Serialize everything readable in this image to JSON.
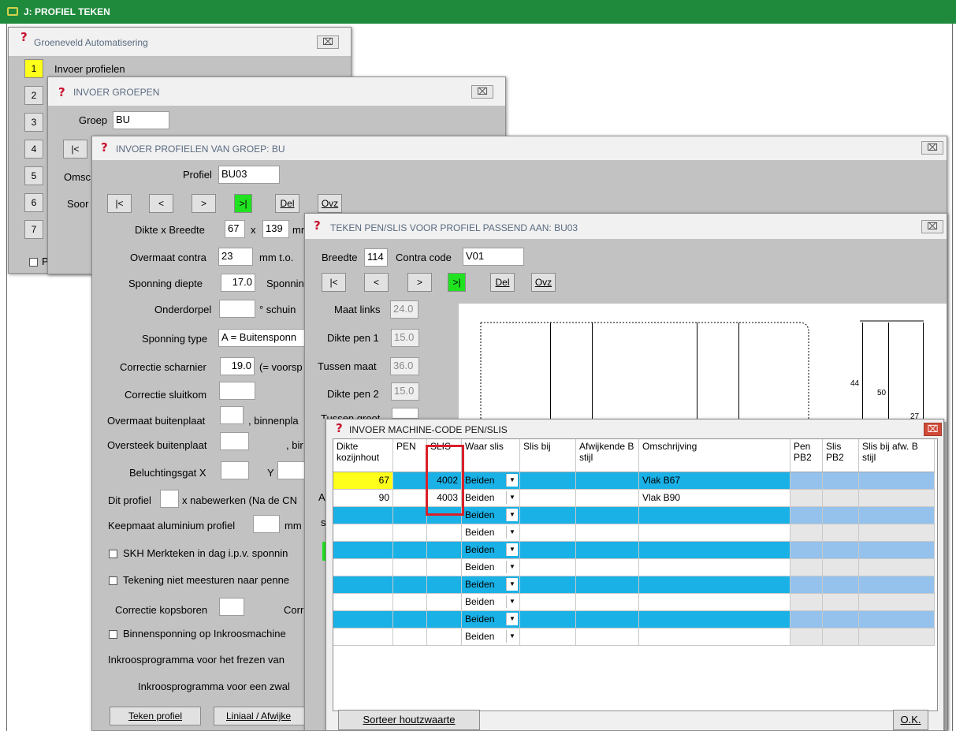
{
  "app": {
    "title": "J: PROFIEL TEKEN"
  },
  "close_glyph": "⌧",
  "colors": {
    "accent_green": "#1f8a3c",
    "highlight_cyan": "#1ab1e6",
    "selected_yellow": "#ffff1c",
    "nav_green": "#21e221"
  },
  "win1": {
    "title": "Groeneveld Automatisering",
    "menu": [
      {
        "num": "1",
        "label": "Invoer profielen"
      },
      {
        "num": "2"
      },
      {
        "num": "3"
      },
      {
        "num": "4"
      },
      {
        "num": "5"
      },
      {
        "num": "6"
      },
      {
        "num": "7"
      }
    ],
    "checkbox_label": "P"
  },
  "win2": {
    "title": "INVOER GROEPEN",
    "groep_label": "Groep",
    "groep_value": "BU",
    "nav_first": "|<",
    "omschrijving_label": "Omsc",
    "soort_label": "Soor"
  },
  "win3": {
    "title": "INVOER PROFIELEN VAN GROEP: BU",
    "profiel_label": "Profiel",
    "profiel_value": "BU03",
    "nav": [
      "|<",
      "<",
      ">",
      ">|"
    ],
    "del": "Del",
    "ovz": "Ovz",
    "dikte_label": "Dikte x Breedte",
    "dikte_value": "67",
    "x_sep": "x",
    "breedte_value": "139",
    "mm_cut": "mm",
    "overmaat_contra_label": "Overmaat contra",
    "overmaat_contra_value": "23",
    "overmaat_contra_unit": "mm  t.o.",
    "sponning_diepte_label": "Sponning diepte",
    "sponning_diepte_value": "17.0",
    "sponning_cut": "Sponnin",
    "onderdorpel_label": "Onderdorpel",
    "onderdorpel_suffix": "° schuin",
    "sponning_type_label": "Sponning type",
    "sponning_type_value": "A = Buitensponn",
    "correctie_scharnier_label": "Correctie scharnier",
    "correctie_scharnier_value": "19.0",
    "correctie_scharnier_suffix": "(= voorsp",
    "correctie_sluitkom_label": "Correctie sluitkom",
    "overmaat_buitenplaat_label": "Overmaat buitenplaat",
    "overmaat_buitenplaat_suffix": ", binnenpla",
    "oversteek_buitenplaat_label": "Oversteek buitenplaat",
    "oversteek_suffix": ", bir",
    "beluchtingsgat_label": "Beluchtingsgat X",
    "beluchtingsgat_y": "Y",
    "dit_profiel_label": "Dit profiel",
    "dit_profiel_suffix": "x nabewerken (Na de CN",
    "keepmaat_label": "Keepmaat aluminium profiel",
    "keepmaat_suffix": "mm",
    "skh_label": "SKH Merkteken in dag i.p.v. sponnin",
    "tekening_label": "Tekening niet meesturen naar penne",
    "correctie_kopsboren_label": "Correctie kopsboren",
    "correctie_cut": "Corr",
    "binnensponning_label": "Binnensponning op Inkroosmachine",
    "inkroos1_label": "Inkroosprogramma voor het frezen van",
    "inkroos2_label": "Inkroosprogramma voor een zwal",
    "teken_profiel": "Teken profiel",
    "liniaal": "Liniaal / Afwijke"
  },
  "win4": {
    "title": "TEKEN PEN/SLIS VOOR PROFIEL PASSEND AAN: BU03",
    "breedte_label": "Breedte",
    "breedte_value": "114",
    "contra_label": "Contra code",
    "contra_value": "V01",
    "nav": [
      "|<",
      "<",
      ">",
      ">|"
    ],
    "del": "Del",
    "ovz": "Ovz",
    "maat_links_label": "Maat links",
    "maat_links_value": "24.0",
    "dikte_pen1_label": "Dikte pen 1",
    "dikte_pen1_value": "15.0",
    "tussen_maat_label": "Tussen maat",
    "tussen_maat_value": "36.0",
    "dikte_pen2_label": "Dikte pen 2",
    "dikte_pen2_value": "15.0",
    "cut_label": "Tussen groot",
    "side_a": "A",
    "side_s": "s",
    "dim_44": "44",
    "dim_50": "50",
    "dim_27": "27"
  },
  "win5": {
    "title": "INVOER MACHINE-CODE PEN/SLIS",
    "columns": [
      "Dikte kozijnhout",
      "PEN",
      "SLIS",
      "Waar slis",
      "Slis bij",
      "Afwijkende B stijl",
      "Omschrijving",
      "Pen PB2",
      "Slis PB2",
      "Slis bij afw. B stijl"
    ],
    "rows": [
      {
        "dikte": "67",
        "pen": "",
        "slis": "4002",
        "waar": "Beiden",
        "slisbij": "",
        "afw": "",
        "omschr": "Vlak B67",
        "penpb2": "",
        "slispb2": "",
        "slisafw": ""
      },
      {
        "dikte": "90",
        "pen": "",
        "slis": "4003",
        "waar": "Beiden",
        "slisbij": "",
        "afw": "",
        "omschr": "Vlak B90",
        "penpb2": "",
        "slispb2": "",
        "slisafw": ""
      },
      {
        "dikte": "",
        "pen": "",
        "slis": "",
        "waar": "Beiden",
        "slisbij": "",
        "afw": "",
        "omschr": "",
        "penpb2": "",
        "slispb2": "",
        "slisafw": ""
      },
      {
        "dikte": "",
        "pen": "",
        "slis": "",
        "waar": "Beiden",
        "slisbij": "",
        "afw": "",
        "omschr": "",
        "penpb2": "",
        "slispb2": "",
        "slisafw": ""
      },
      {
        "dikte": "",
        "pen": "",
        "slis": "",
        "waar": "Beiden",
        "slisbij": "",
        "afw": "",
        "omschr": "",
        "penpb2": "",
        "slispb2": "",
        "slisafw": ""
      },
      {
        "dikte": "",
        "pen": "",
        "slis": "",
        "waar": "Beiden",
        "slisbij": "",
        "afw": "",
        "omschr": "",
        "penpb2": "",
        "slispb2": "",
        "slisafw": ""
      },
      {
        "dikte": "",
        "pen": "",
        "slis": "",
        "waar": "Beiden",
        "slisbij": "",
        "afw": "",
        "omschr": "",
        "penpb2": "",
        "slispb2": "",
        "slisafw": ""
      },
      {
        "dikte": "",
        "pen": "",
        "slis": "",
        "waar": "Beiden",
        "slisbij": "",
        "afw": "",
        "omschr": "",
        "penpb2": "",
        "slispb2": "",
        "slisafw": ""
      },
      {
        "dikte": "",
        "pen": "",
        "slis": "",
        "waar": "Beiden",
        "slisbij": "",
        "afw": "",
        "omschr": "",
        "penpb2": "",
        "slispb2": "",
        "slisafw": ""
      },
      {
        "dikte": "",
        "pen": "",
        "slis": "",
        "waar": "Beiden",
        "slisbij": "",
        "afw": "",
        "omschr": "",
        "penpb2": "",
        "slispb2": "",
        "slisafw": ""
      }
    ],
    "sorteer": "Sorteer houtzwaarte",
    "ok": "O.K."
  }
}
